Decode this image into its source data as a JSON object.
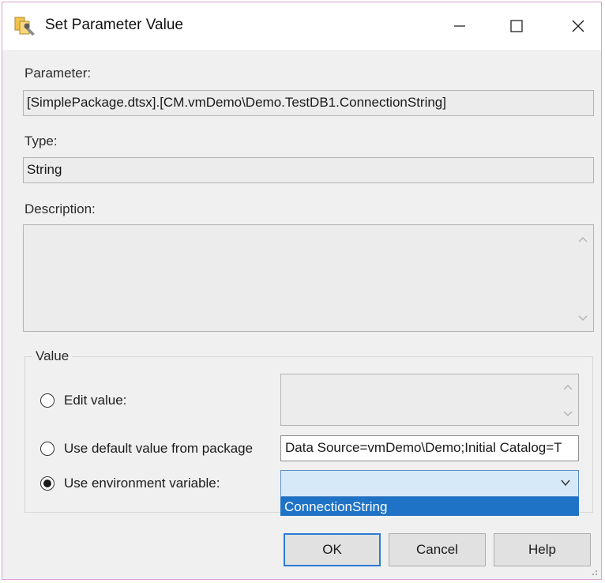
{
  "window": {
    "title": "Set Parameter Value",
    "controls": {
      "minimize": "—",
      "maximize": "☐",
      "close": "✕"
    }
  },
  "parameter": {
    "label": "Parameter:",
    "value": "[SimplePackage.dtsx].[CM.vmDemo\\Demo.TestDB1.ConnectionString]"
  },
  "type": {
    "label": "Type:",
    "value": "String"
  },
  "description": {
    "label": "Description:",
    "value": ""
  },
  "value_group": {
    "title": "Value",
    "options": [
      {
        "label": "Edit value:",
        "selected": false
      },
      {
        "label": "Use default value from package",
        "selected": false
      },
      {
        "label": "Use environment variable:",
        "selected": true
      }
    ],
    "edit_value": "",
    "default_value": "Data Source=vmDemo\\Demo;Initial Catalog=T",
    "environment_variable": {
      "selected": "",
      "options": [
        "ConnectionString"
      ]
    }
  },
  "buttons": {
    "ok": "OK",
    "cancel": "Cancel",
    "help": "Help"
  },
  "colors": {
    "accent": "#1e73c7",
    "combo_bg": "#d6e9f8",
    "dialog_bg": "#f0f0f0"
  }
}
